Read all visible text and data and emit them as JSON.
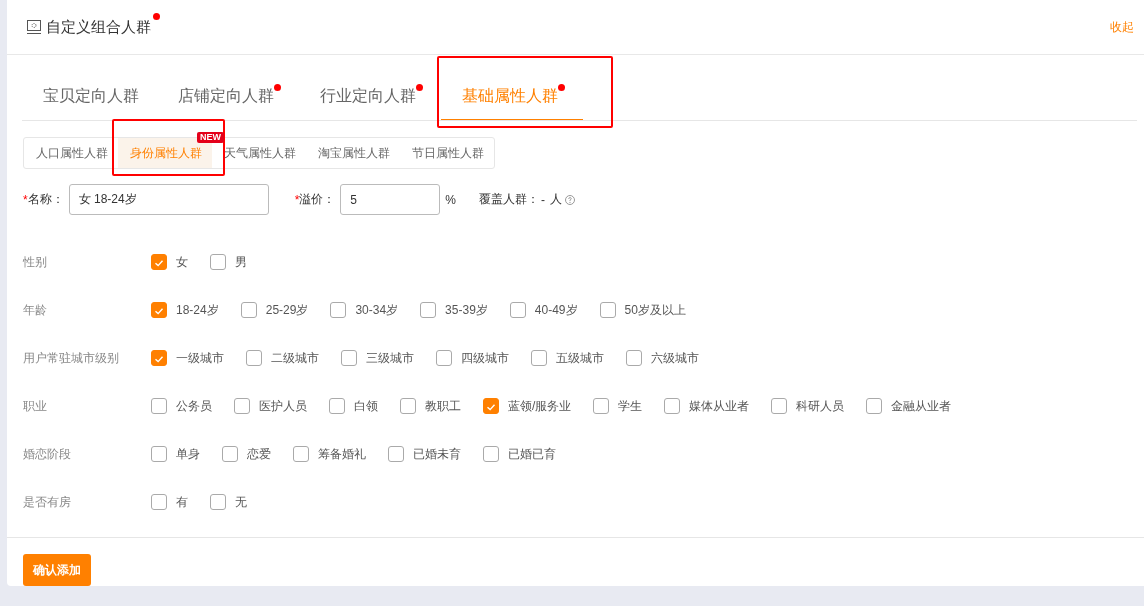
{
  "header": {
    "title": "自定义组合人群",
    "dot": true,
    "collapse_link": "收起"
  },
  "tabs": [
    {
      "label": "宝贝定向人群",
      "selected": false,
      "dot": false,
      "highlighted": false
    },
    {
      "label": "店铺定向人群",
      "selected": false,
      "dot": true,
      "highlighted": false
    },
    {
      "label": "行业定向人群",
      "selected": false,
      "dot": true,
      "highlighted": false
    },
    {
      "label": "基础属性人群",
      "selected": true,
      "dot": true,
      "highlighted": true
    }
  ],
  "subtabs": [
    {
      "label": "人口属性人群",
      "selected": false,
      "highlighted": false
    },
    {
      "label": "身份属性人群",
      "selected": true,
      "badge": "NEW",
      "highlighted": true
    },
    {
      "label": "天气属性人群",
      "selected": false,
      "highlighted": false
    },
    {
      "label": "淘宝属性人群",
      "selected": false,
      "highlighted": false
    },
    {
      "label": "节日属性人群",
      "selected": false,
      "highlighted": false
    }
  ],
  "form": {
    "name_required": "*",
    "premium_required": "*",
    "name_label": "名称：",
    "name_value": "女 18-24岁",
    "premium_label": "溢价：",
    "premium_value": "5",
    "premium_unit": "%",
    "coverage_label": "覆盖人群：",
    "coverage_value": "-",
    "coverage_unit": "人"
  },
  "groups": [
    {
      "label": "性别",
      "options": [
        {
          "label": "女",
          "checked": true
        },
        {
          "label": "男",
          "checked": false
        }
      ]
    },
    {
      "label": "年龄",
      "options": [
        {
          "label": "18-24岁",
          "checked": true
        },
        {
          "label": "25-29岁",
          "checked": false
        },
        {
          "label": "30-34岁",
          "checked": false
        },
        {
          "label": "35-39岁",
          "checked": false
        },
        {
          "label": "40-49岁",
          "checked": false
        },
        {
          "label": "50岁及以上",
          "checked": false
        }
      ]
    },
    {
      "label": "用户常驻城市级别",
      "options": [
        {
          "label": "一级城市",
          "checked": true
        },
        {
          "label": "二级城市",
          "checked": false
        },
        {
          "label": "三级城市",
          "checked": false
        },
        {
          "label": "四级城市",
          "checked": false
        },
        {
          "label": "五级城市",
          "checked": false
        },
        {
          "label": "六级城市",
          "checked": false
        }
      ]
    },
    {
      "label": "职业",
      "options": [
        {
          "label": "公务员",
          "checked": false
        },
        {
          "label": "医护人员",
          "checked": false
        },
        {
          "label": "白领",
          "checked": false
        },
        {
          "label": "教职工",
          "checked": false
        },
        {
          "label": "蓝领/服务业",
          "checked": true
        },
        {
          "label": "学生",
          "checked": false
        },
        {
          "label": "媒体从业者",
          "checked": false
        },
        {
          "label": "科研人员",
          "checked": false
        },
        {
          "label": "金融从业者",
          "checked": false
        }
      ]
    },
    {
      "label": "婚恋阶段",
      "options": [
        {
          "label": "单身",
          "checked": false
        },
        {
          "label": "恋爱",
          "checked": false
        },
        {
          "label": "筹备婚礼",
          "checked": false
        },
        {
          "label": "已婚未育",
          "checked": false
        },
        {
          "label": "已婚已育",
          "checked": false
        }
      ]
    },
    {
      "label": "是否有房",
      "options": [
        {
          "label": "有",
          "checked": false
        },
        {
          "label": "无",
          "checked": false
        }
      ]
    }
  ],
  "confirm_button": "确认添加"
}
